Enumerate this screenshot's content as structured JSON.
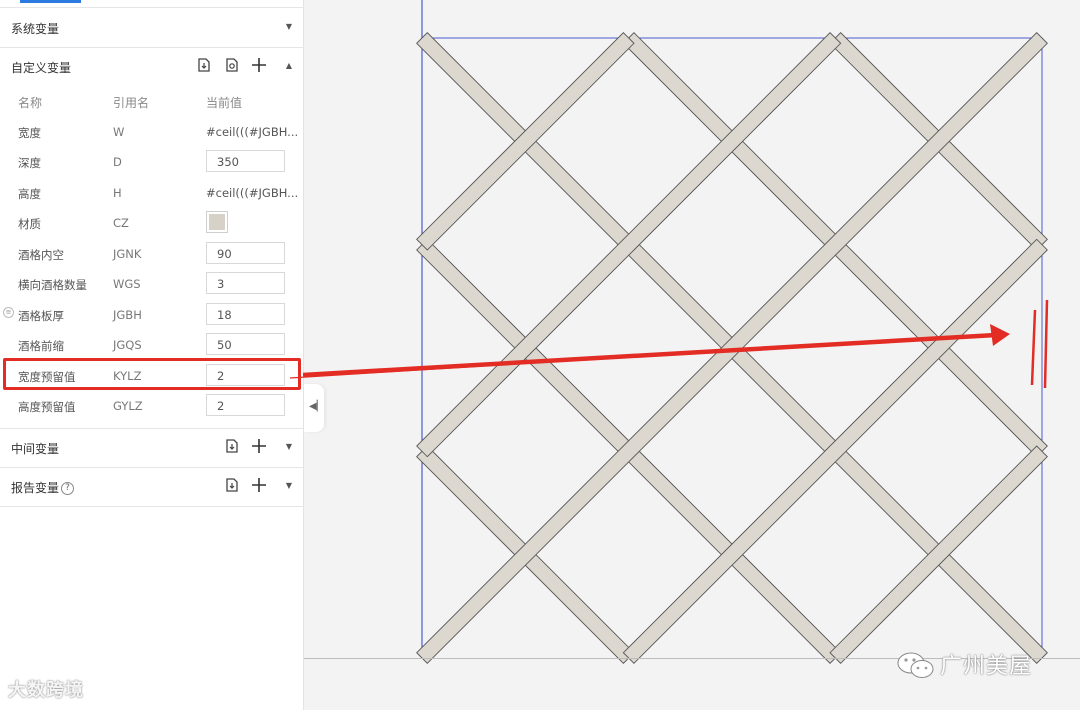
{
  "sections": {
    "system": {
      "title": "系统变量"
    },
    "custom": {
      "title": "自定义变量"
    },
    "middle": {
      "title": "中间变量"
    },
    "report": {
      "title": "报告变量"
    }
  },
  "columns": {
    "name": "名称",
    "ref": "引用名",
    "value": "当前值"
  },
  "rows": [
    {
      "name": "宽度",
      "ref": "W",
      "value": "#ceil(((#JGBH..."
    },
    {
      "name": "深度",
      "ref": "D",
      "value": "350"
    },
    {
      "name": "高度",
      "ref": "H",
      "value": "#ceil(((#JGBH..."
    },
    {
      "name": "材质",
      "ref": "CZ",
      "value": ""
    },
    {
      "name": "酒格内空",
      "ref": "JGNK",
      "value": "90"
    },
    {
      "name": "横向酒格数量",
      "ref": "WGS",
      "value": "3"
    },
    {
      "name": "酒格板厚",
      "ref": "JGBH",
      "value": "18"
    },
    {
      "name": "酒格前缩",
      "ref": "JGQS",
      "value": "50"
    },
    {
      "name": "宽度预留值",
      "ref": "KYLZ",
      "value": "2"
    },
    {
      "name": "高度预留值",
      "ref": "GYLZ",
      "value": "2"
    }
  ],
  "colors": {
    "accent": "#2d7be0",
    "annotation": "#e22c24",
    "material": "#d6d2c7",
    "slat": "#dcd8cf",
    "frame": "#4a5bd0"
  },
  "watermarks": {
    "left": "大数跨境",
    "right": "广州美屋"
  }
}
